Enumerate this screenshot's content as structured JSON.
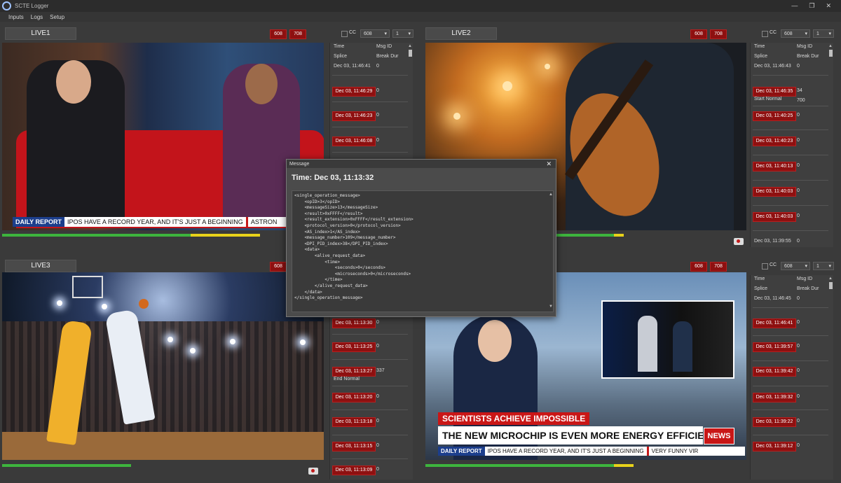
{
  "app": {
    "title": "SCTE Logger",
    "menu": [
      "Inputs",
      "Logs",
      "Setup"
    ],
    "win_buttons": [
      "—",
      "❐",
      "✕"
    ]
  },
  "colors": {
    "badge": "#8e1010",
    "meter_green": "#3db43d",
    "meter_yellow": "#e8d21a",
    "news_red": "#c91616",
    "ticker_blue": "#1c3e8c"
  },
  "panels": [
    {
      "name": "LIVE1",
      "badges": [
        "608",
        "708"
      ],
      "cc_label": "CC",
      "cc_select": "608",
      "stream_select": "1",
      "log_headers": {
        "h1": "Time",
        "h2": "Msg ID",
        "h3": "Splice",
        "h4": "Break Dur"
      },
      "first_plain": {
        "time": "Dec 03, 11:46:41",
        "val": "0"
      },
      "entries": [
        {
          "time": "Dec 03, 11:46:29",
          "val": "0",
          "sub": ""
        },
        {
          "time": "Dec 03, 11:46:23",
          "val": "0",
          "sub": ""
        },
        {
          "time": "Dec 03, 11:46:08",
          "val": "0",
          "sub": ""
        }
      ],
      "ticker": {
        "label": "DAILY REPORT",
        "text": "IPOS HAVE A RECORD YEAR, AND IT'S JUST A BEGINNING",
        "tail": "ASTRON"
      },
      "meter": {
        "green": 0.57,
        "yellow": 0.21
      }
    },
    {
      "name": "LIVE2",
      "badges": [
        "608",
        "708"
      ],
      "cc_label": "CC",
      "cc_select": "608",
      "stream_select": "1",
      "log_headers": {
        "h1": "Time",
        "h2": "Msg ID",
        "h3": "Splice",
        "h4": "Break Dur"
      },
      "first_plain": {
        "time": "Dec 03, 11:46:43",
        "val": "0"
      },
      "entries": [
        {
          "time": "Dec 03, 11:46:35",
          "val": "34",
          "sub": "Start Normal",
          "sub_val": "700"
        },
        {
          "time": "Dec 03, 11:40:25",
          "val": "0",
          "sub": ""
        },
        {
          "time": "Dec 03, 11:40:23",
          "val": "0",
          "sub": ""
        },
        {
          "time": "Dec 03, 11:40:13",
          "val": "0",
          "sub": ""
        },
        {
          "time": "Dec 03, 11:40:03",
          "val": "0",
          "sub": ""
        },
        {
          "time": "Dec 03, 11:40:03",
          "val": "0",
          "sub": ""
        },
        {
          "time": "Dec 03, 11:39:55",
          "val": "0",
          "sub": ""
        }
      ],
      "meter": {
        "green": 0.57,
        "yellow": 0.03
      }
    },
    {
      "name": "LIVE3",
      "badges": [
        "608",
        "708"
      ],
      "entries": [
        {
          "time": "Dec 03, 11:13:30",
          "val": "0",
          "sub": ""
        },
        {
          "time": "Dec 03, 11:13:25",
          "val": "0",
          "sub": ""
        },
        {
          "time": "Dec 03, 11:13:27",
          "val": "337",
          "sub": "End Normal"
        },
        {
          "time": "Dec 03, 11:13:20",
          "val": "0",
          "sub": ""
        },
        {
          "time": "Dec 03, 11:13:18",
          "val": "0",
          "sub": ""
        },
        {
          "time": "Dec 03, 11:13:15",
          "val": "0",
          "sub": ""
        },
        {
          "time": "Dec 03, 11:13:09",
          "val": "0",
          "sub": ""
        }
      ],
      "meter": {
        "green": 0.39,
        "yellow": 0.0
      }
    },
    {
      "name": "",
      "badges": [
        "608",
        "708"
      ],
      "cc_label": "CC",
      "cc_select": "608",
      "stream_select": "1",
      "log_headers": {
        "h1": "Time",
        "h2": "Msg ID",
        "h3": "Splice",
        "h4": "Break Dur"
      },
      "first_plain": {
        "time": "Dec 03, 11:46:45",
        "val": "0"
      },
      "entries": [
        {
          "time": "Dec 03, 11:46:41",
          "val": "0",
          "sub": ""
        },
        {
          "time": "Dec 03, 11:39:57",
          "val": "0",
          "sub": ""
        },
        {
          "time": "Dec 03, 11:39:42",
          "val": "0",
          "sub": ""
        },
        {
          "time": "Dec 03, 11:39:32",
          "val": "0",
          "sub": ""
        },
        {
          "time": "Dec 03, 11:39:22",
          "val": "0",
          "sub": ""
        },
        {
          "time": "Dec 03, 11:39:12",
          "val": "0",
          "sub": ""
        }
      ],
      "news": {
        "headline": "SCIENTISTS ACHIEVE IMPOSSIBLE",
        "main": "THE NEW MICROCHIP IS EVEN MORE ENERGY EFFICIENT",
        "logo": "NEWS",
        "ticker_label": "DAILY REPORT",
        "ticker_text": "IPOS HAVE A RECORD YEAR, AND IT'S JUST A BEGINNING",
        "ticker_tail": "VERY FUNNY VIR"
      },
      "meter": {
        "green": 0.57,
        "yellow": 0.06
      }
    }
  ],
  "dialog": {
    "title": "Message",
    "close": "✕",
    "time": "Time: Dec 03, 11:13:32",
    "xml": [
      "<single_operation_message>",
      "    <opID>3</opID>",
      "    <messageSize>13</messageSize>",
      "    <result>0xFFFF</result>",
      "    <result_extension>0xFFFF</result_extension>",
      "    <protocol_version>0</protocol_version>",
      "    <AS_index>1</AS_index>",
      "    <message_number>109</message_number>",
      "    <DPI_PID_index>38</DPI_PID_index>",
      "    <data>",
      "        <alive_request_data>",
      "            <time>",
      "                <seconds>0</seconds>",
      "                <microseconds>0</microseconds>",
      "            </time>",
      "        </alive_request_data>",
      "    </data>",
      "</single_operation_message>"
    ]
  }
}
